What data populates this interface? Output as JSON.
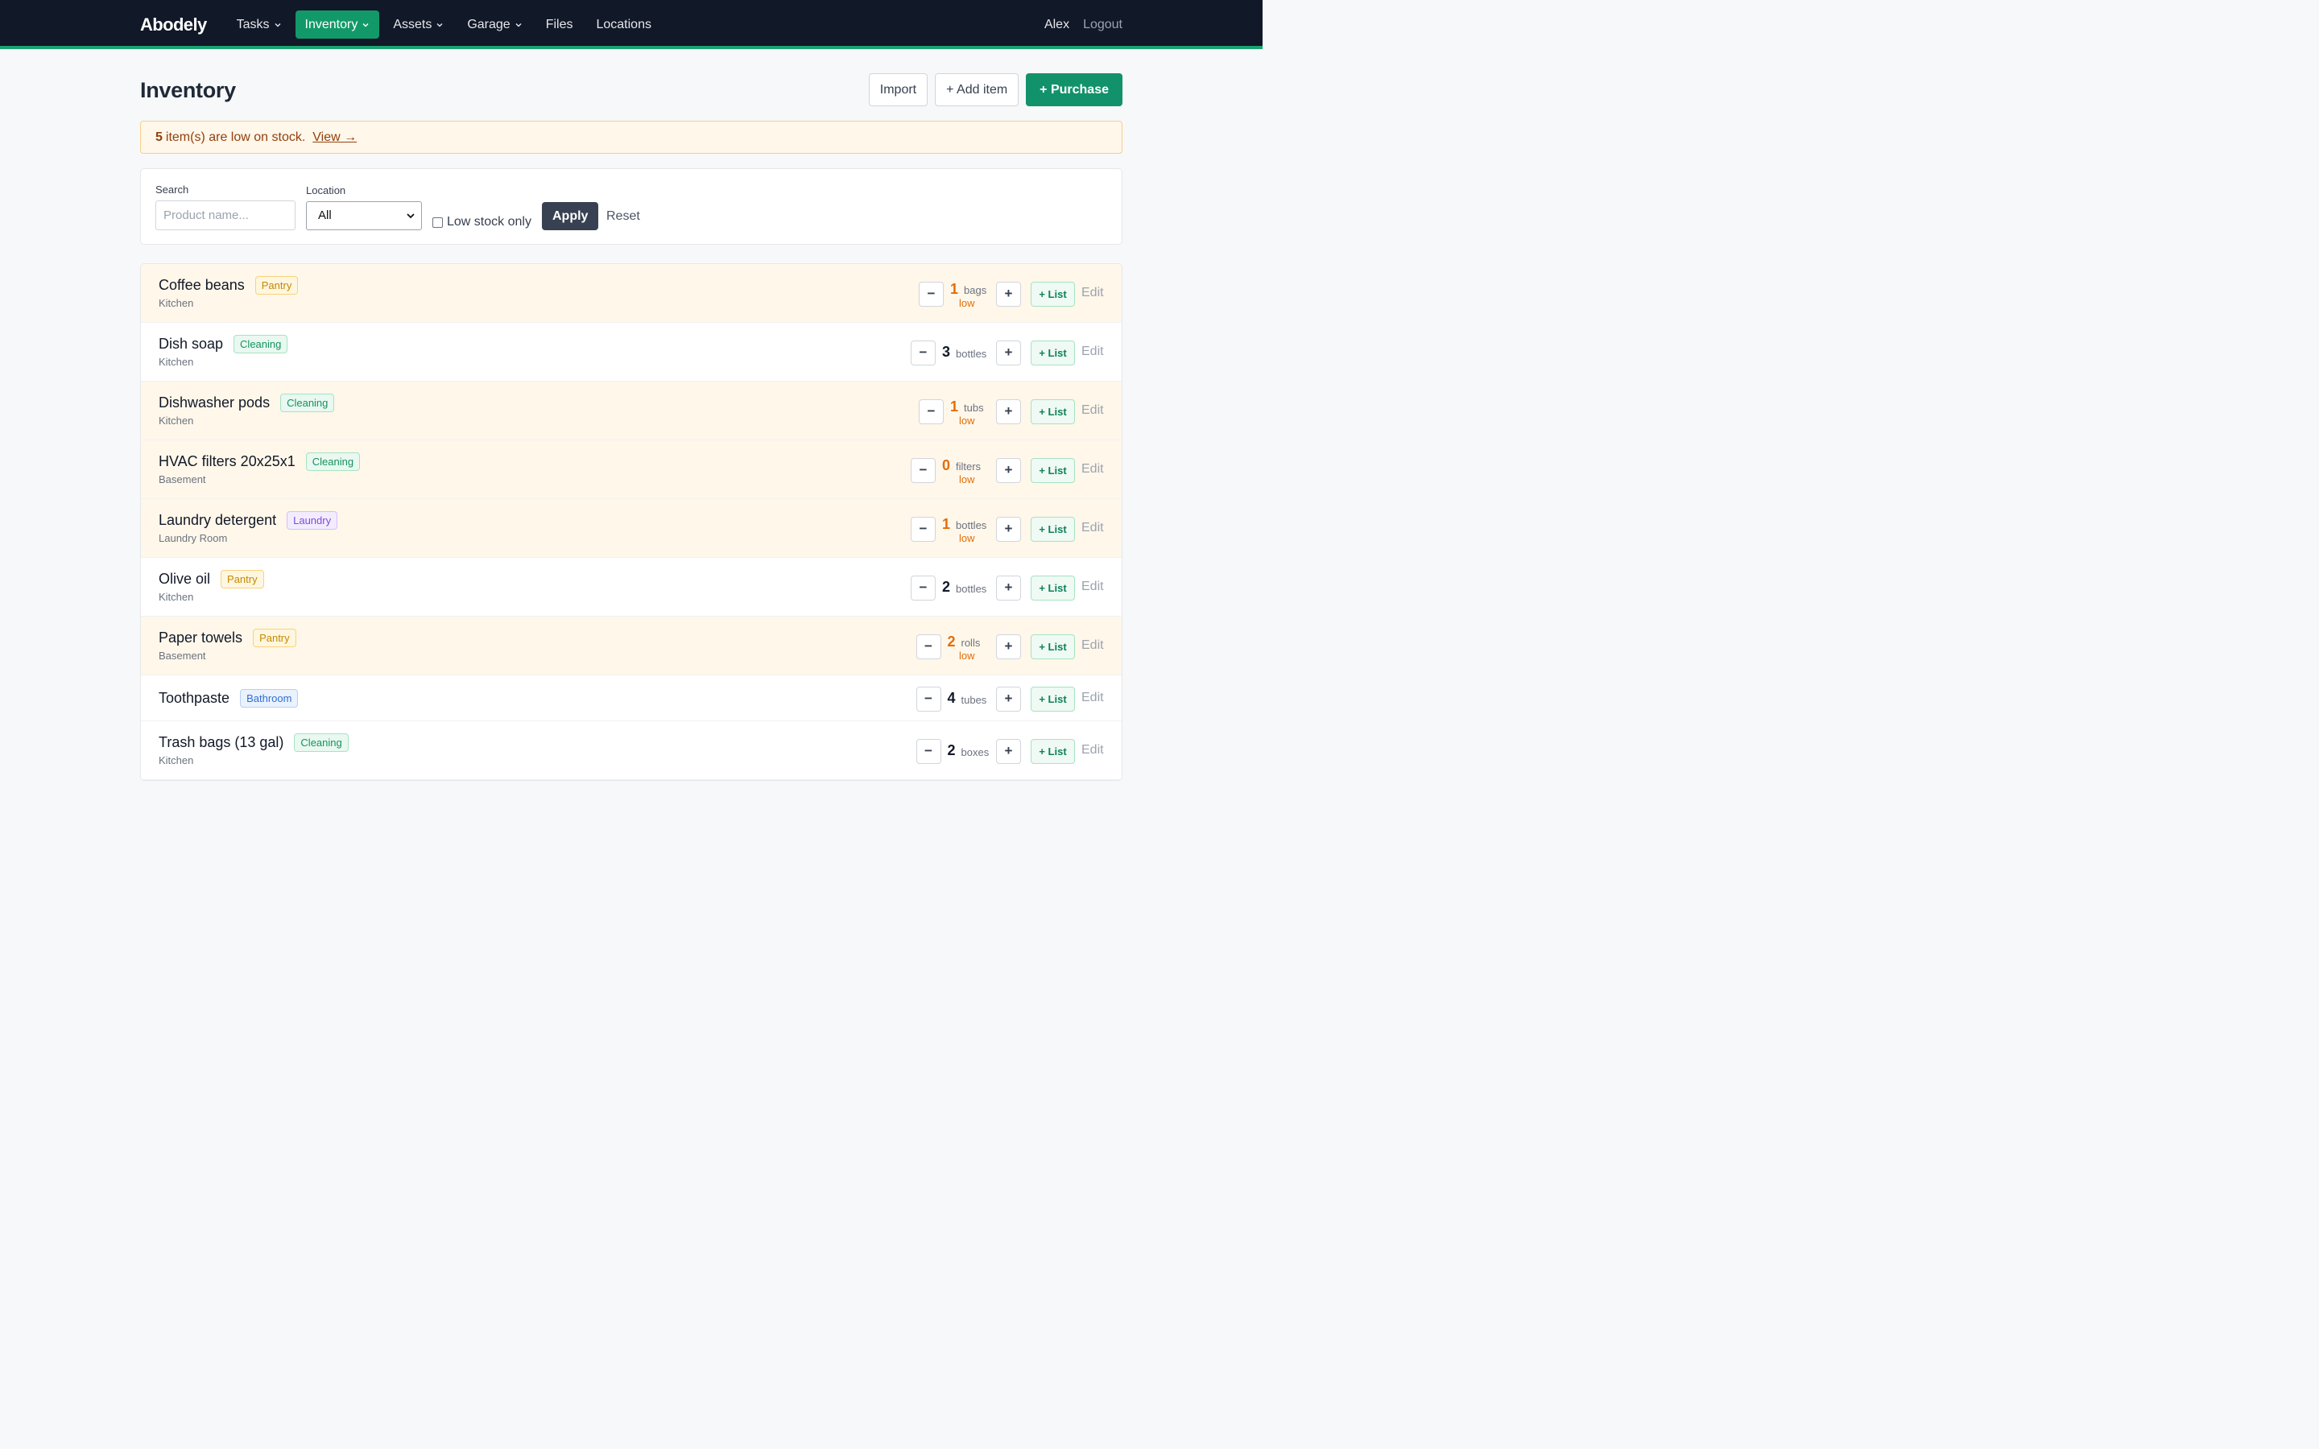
{
  "nav": {
    "brand": "Abodely",
    "items": [
      {
        "label": "Tasks",
        "dropdown": true,
        "active": false
      },
      {
        "label": "Inventory",
        "dropdown": true,
        "active": true
      },
      {
        "label": "Assets",
        "dropdown": true,
        "active": false
      },
      {
        "label": "Garage",
        "dropdown": true,
        "active": false
      },
      {
        "label": "Files",
        "dropdown": false,
        "active": false
      },
      {
        "label": "Locations",
        "dropdown": false,
        "active": false
      }
    ],
    "user": "Alex",
    "logout": "Logout"
  },
  "page": {
    "title": "Inventory",
    "import_label": "Import",
    "add_item_label": "+ Add item",
    "purchase_label": "+ Purchase"
  },
  "alert": {
    "count": "5",
    "text": "item(s) are low on stock.",
    "link": "View →"
  },
  "filters": {
    "search_label": "Search",
    "search_placeholder": "Product name...",
    "location_label": "Location",
    "location_value": "All",
    "low_stock_label": "Low stock only",
    "low_stock_checked": false,
    "apply_label": "Apply",
    "reset_label": "Reset"
  },
  "items": [
    {
      "name": "Coffee beans",
      "category": "Pantry",
      "location": "Kitchen",
      "qty": "1",
      "unit": "bags",
      "low": true
    },
    {
      "name": "Dish soap",
      "category": "Cleaning",
      "location": "Kitchen",
      "qty": "3",
      "unit": "bottles",
      "low": false
    },
    {
      "name": "Dishwasher pods",
      "category": "Cleaning",
      "location": "Kitchen",
      "qty": "1",
      "unit": "tubs",
      "low": true
    },
    {
      "name": "HVAC filters 20x25x1",
      "category": "Cleaning",
      "location": "Basement",
      "qty": "0",
      "unit": "filters",
      "low": true
    },
    {
      "name": "Laundry detergent",
      "category": "Laundry",
      "location": "Laundry Room",
      "qty": "1",
      "unit": "bottles",
      "low": true
    },
    {
      "name": "Olive oil",
      "category": "Pantry",
      "location": "Kitchen",
      "qty": "2",
      "unit": "bottles",
      "low": false
    },
    {
      "name": "Paper towels",
      "category": "Pantry",
      "location": "Basement",
      "qty": "2",
      "unit": "rolls",
      "low": true
    },
    {
      "name": "Toothpaste",
      "category": "Bathroom",
      "location": "",
      "qty": "4",
      "unit": "tubes",
      "low": false
    },
    {
      "name": "Trash bags (13 gal)",
      "category": "Cleaning",
      "location": "Kitchen",
      "qty": "2",
      "unit": "boxes",
      "low": false
    }
  ],
  "row_labels": {
    "decrement": "−",
    "increment": "+",
    "add_to_list": "+ List",
    "edit": "Edit",
    "low_tag": "low"
  },
  "colors": {
    "navbar": "#111827",
    "accent": "#12926a",
    "low_row": "#fff7ea",
    "low_text": "#e26d08"
  }
}
